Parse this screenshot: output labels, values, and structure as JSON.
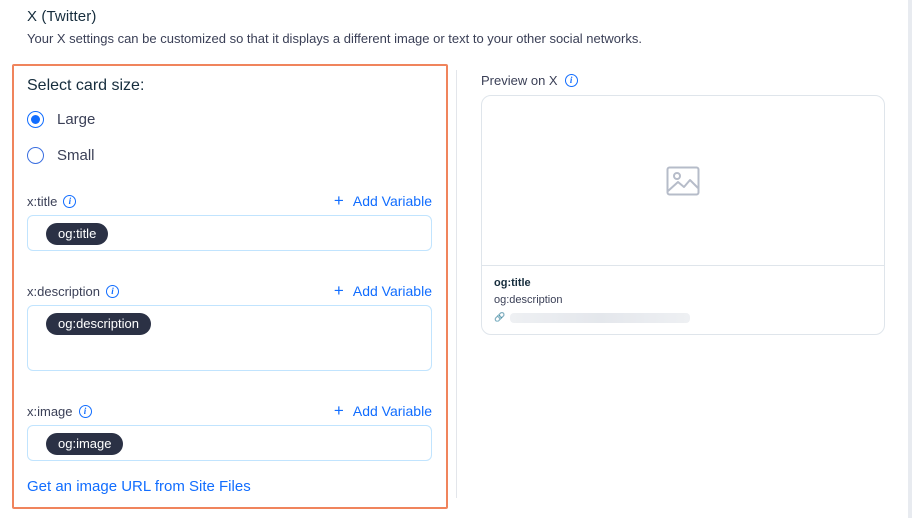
{
  "section": {
    "title": "X (Twitter)",
    "subtitle": "Your X settings can be customized so that it displays a different image or text to your other social networks."
  },
  "card_size": {
    "label": "Select card size:",
    "options": [
      {
        "label": "Large",
        "checked": true
      },
      {
        "label": "Small",
        "checked": false
      }
    ]
  },
  "fields": {
    "title": {
      "label": "x:title",
      "chip": "og:title"
    },
    "description": {
      "label": "x:description",
      "chip": "og:description"
    },
    "image": {
      "label": "x:image",
      "chip": "og:image"
    },
    "add_variable_label": "Add Variable"
  },
  "site_files_link": "Get an image URL from Site Files",
  "preview": {
    "label": "Preview on X",
    "title": "og:title",
    "description": "og:description"
  },
  "colors": {
    "accent": "#116dff",
    "highlight_border": "#f0845c",
    "chip_bg": "#2b3145"
  },
  "icons": [
    "info-icon",
    "plus-icon",
    "image-placeholder-icon",
    "link-icon"
  ]
}
